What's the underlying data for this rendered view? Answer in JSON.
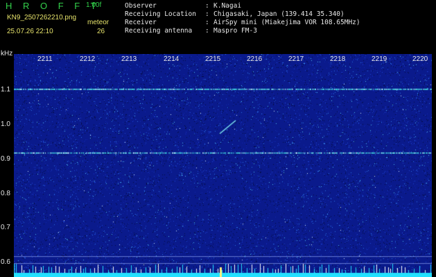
{
  "header": {
    "app_title": "H R O F F T",
    "version": "1.00f",
    "file_name": "KN9_2507262210.png",
    "timestamp": "25.07.26 22:10",
    "meteor_label": "meteor",
    "meteor_count": "26"
  },
  "info": [
    {
      "key": "Observer",
      "sep": ":",
      "value": "K.Nagai"
    },
    {
      "key": "Receiving Location",
      "sep": ":",
      "value": "Chigasaki, Japan (139.414 35.340)"
    },
    {
      "key": "Receiver",
      "sep": ":",
      "value": "AirSpy mini (Miakejima VOR 108.65MHz)"
    },
    {
      "key": "Receiving antenna",
      "sep": ":",
      "value": "Maspro FM-3"
    }
  ],
  "axis": {
    "y_unit": "kHz",
    "y_ticks": [
      "1.1",
      "1.0",
      "0.9",
      "0.8",
      "0.7",
      "0.6"
    ],
    "x_ticks": [
      "2211",
      "2212",
      "2213",
      "2214",
      "2215",
      "2216",
      "2217",
      "2218",
      "2219",
      "2220"
    ]
  },
  "colors": {
    "background": "#000000",
    "spectrogram_base": "#0a1a8c",
    "carrier_line": "#3fd7e0",
    "bottom_band": "#22e0ff",
    "title_green": "#33d14b",
    "file_yellow": "#e6e36b",
    "info_text": "#e8e8e8"
  }
}
